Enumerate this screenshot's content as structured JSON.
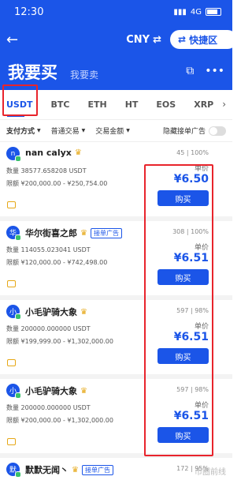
{
  "status": {
    "time": "12:30",
    "network": "4G"
  },
  "nav": {
    "currency": "CNY",
    "swap_glyph": "⇄",
    "quick_label": "快捷区"
  },
  "tabs": {
    "buy": "我要买",
    "sell": "我要卖"
  },
  "coins": [
    "USDT",
    "BTC",
    "ETH",
    "HT",
    "EOS",
    "XRP"
  ],
  "filters": {
    "payment": "支付方式",
    "trade": "普通交易",
    "amount": "交易金额",
    "hide": "隐藏接单广告"
  },
  "labels": {
    "unit": "单价",
    "buy": "购买",
    "maker_tag": "接单广告"
  },
  "listings": [
    {
      "avatar": "n",
      "name": "nan calyx",
      "maker": false,
      "stats": "45 | 100%",
      "qty": "数量 38577.658208 USDT",
      "limit": "限额 ¥200,000.00 - ¥250,754.00",
      "price": "¥6.50"
    },
    {
      "avatar": "华",
      "name": "华尔街喜之郎",
      "maker": true,
      "stats": "308 | 100%",
      "qty": "数量 114055.023041 USDT",
      "limit": "限额 ¥120,000.00 - ¥742,498.00",
      "price": "¥6.51"
    },
    {
      "avatar": "小",
      "name": "小毛驴骑大象",
      "maker": false,
      "stats": "597 | 98%",
      "qty": "数量 200000.000000 USDT",
      "limit": "限额 ¥199,999.00 - ¥1,302,000.00",
      "price": "¥6.51"
    },
    {
      "avatar": "小",
      "name": "小毛驴骑大象",
      "maker": false,
      "stats": "597 | 98%",
      "qty": "数量 200000.000000 USDT",
      "limit": "限额 ¥200,000.00 - ¥1,302,000.00",
      "price": "¥6.51"
    }
  ],
  "peek": {
    "avatar": "默",
    "name": "默默无闻丶",
    "stats": "172 | 95%"
  },
  "watermark": "币圈前线",
  "colors": {
    "brand": "#1b55e8",
    "highlight": "#e8242c"
  }
}
